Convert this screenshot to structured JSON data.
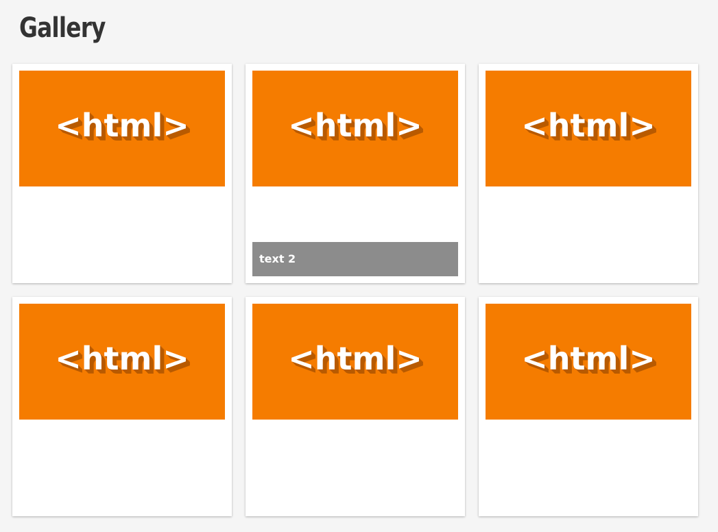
{
  "page": {
    "title": "Gallery"
  },
  "gallery": {
    "items": [
      {
        "logo_text": "<html>",
        "caption": "",
        "caption_visible": false
      },
      {
        "logo_text": "<html>",
        "caption": "text 2",
        "caption_visible": true
      },
      {
        "logo_text": "<html>",
        "caption": "",
        "caption_visible": false
      },
      {
        "logo_text": "<html>",
        "caption": "",
        "caption_visible": false
      },
      {
        "logo_text": "<html>",
        "caption": "",
        "caption_visible": false
      },
      {
        "logo_text": "<html>",
        "caption": "",
        "caption_visible": false
      }
    ]
  },
  "colors": {
    "page_background": "#f5f5f5",
    "card_background": "#ffffff",
    "thumbnail_background": "#f57c00",
    "logo_text": "#ffffff",
    "logo_shadow": "#b85a00",
    "caption_background": "#8c8c8c",
    "title_text": "#333333"
  }
}
